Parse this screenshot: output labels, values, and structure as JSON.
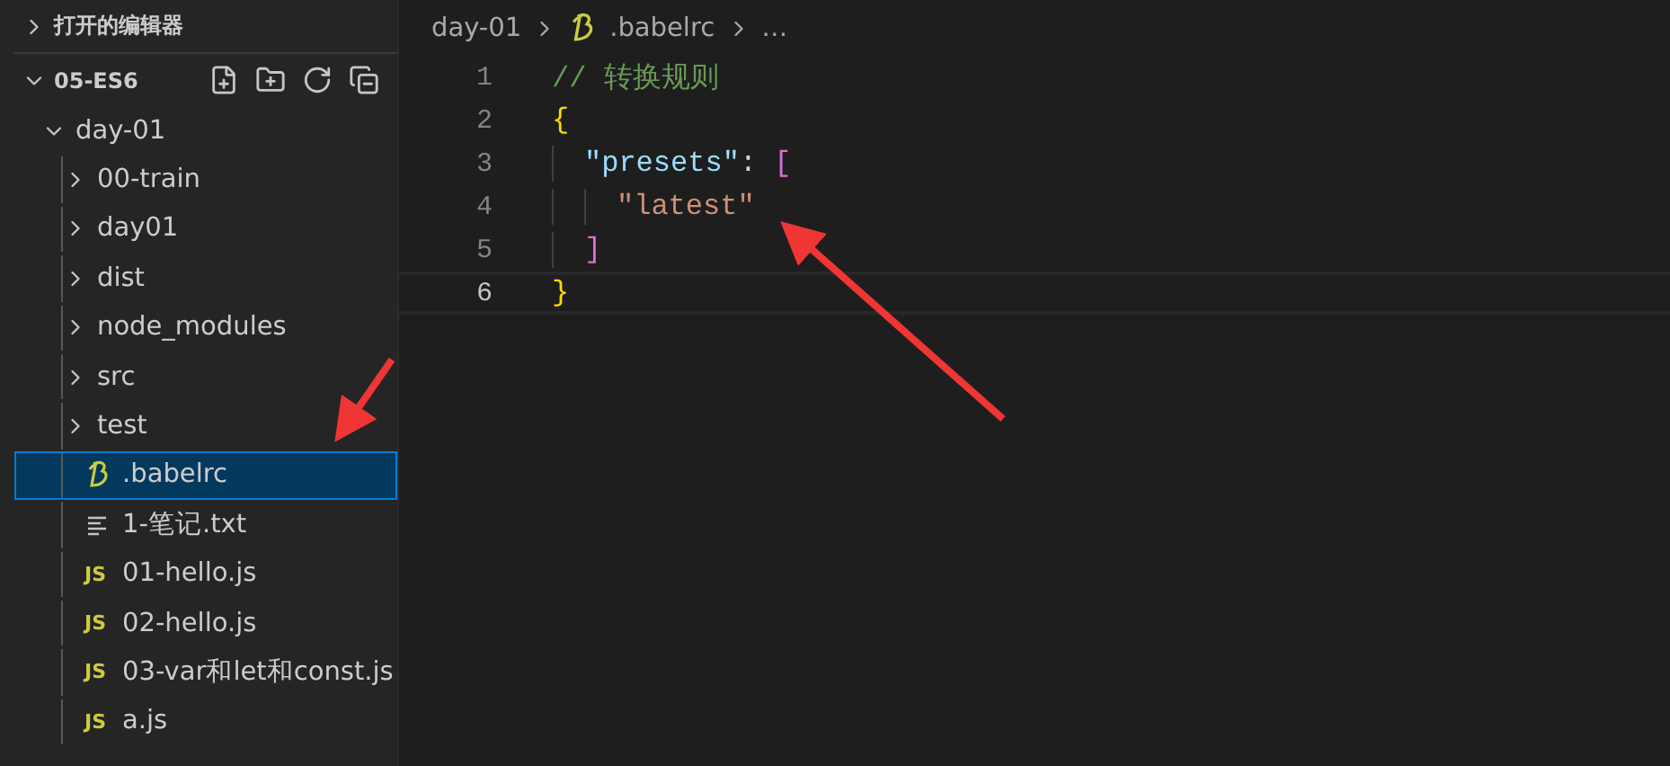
{
  "sidebar": {
    "open_editors": {
      "label": "打开的编辑器",
      "expanded": false
    },
    "folder": {
      "label": "05-ES6",
      "expanded": true,
      "children": [
        {
          "label": "day-01",
          "kind": "folder",
          "expanded": true,
          "selected": false,
          "children": [
            {
              "label": "00-train",
              "kind": "folder",
              "expanded": false,
              "selected": false
            },
            {
              "label": "day01",
              "kind": "folder",
              "expanded": false,
              "selected": false
            },
            {
              "label": "dist",
              "kind": "folder",
              "expanded": false,
              "selected": false
            },
            {
              "label": "node_modules",
              "kind": "folder",
              "expanded": false,
              "selected": false
            },
            {
              "label": "src",
              "kind": "folder",
              "expanded": false,
              "selected": false
            },
            {
              "label": "test",
              "kind": "folder",
              "expanded": false,
              "selected": false
            },
            {
              "label": ".babelrc",
              "kind": "babel",
              "selected": true
            },
            {
              "label": "1-笔记.txt",
              "kind": "text",
              "selected": false
            },
            {
              "label": "01-hello.js",
              "kind": "js",
              "icon_text": "JS",
              "selected": false
            },
            {
              "label": "02-hello.js",
              "kind": "js",
              "icon_text": "JS",
              "selected": false
            },
            {
              "label": "03-var和let和const.js",
              "kind": "js",
              "icon_text": "JS",
              "selected": false
            },
            {
              "label": "a.js",
              "kind": "js",
              "icon_text": "JS",
              "selected": false
            }
          ]
        }
      ]
    }
  },
  "editor": {
    "breadcrumbs": [
      {
        "label": "day-01",
        "kind": "folder"
      },
      {
        "label": ".babelrc",
        "kind": "babel"
      },
      {
        "label": "…",
        "kind": "more"
      }
    ],
    "lines": [
      {
        "number": "1",
        "current": false,
        "tokens": [
          {
            "kind": "comment",
            "text": "// 转换规则"
          }
        ]
      },
      {
        "number": "2",
        "current": false,
        "tokens": [
          {
            "kind": "brace",
            "text": "{"
          }
        ],
        "children": [
          {
            "number": "3",
            "current": false,
            "tokens": [
              {
                "kind": "key",
                "text": "\"presets\""
              },
              {
                "kind": "punct",
                "text": ": "
              },
              {
                "kind": "bracket",
                "text": "["
              }
            ],
            "children": [
              {
                "number": "4",
                "current": false,
                "tokens": [
                  {
                    "kind": "string",
                    "text": "\"latest\""
                  }
                ]
              }
            ]
          },
          {
            "number": "5",
            "current": false,
            "tokens": [
              {
                "kind": "bracket",
                "text": "]"
              }
            ]
          }
        ]
      },
      {
        "number": "6",
        "current": true,
        "tokens": [
          {
            "kind": "brace",
            "text": "}"
          }
        ]
      }
    ]
  }
}
